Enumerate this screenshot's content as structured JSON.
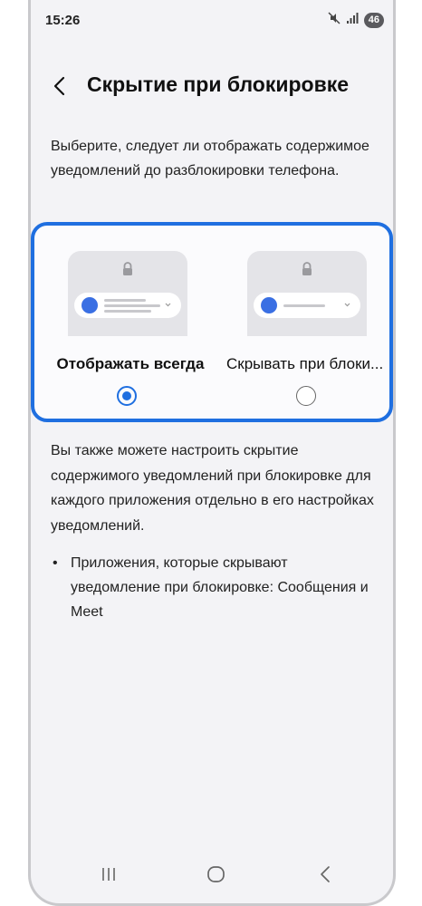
{
  "status": {
    "time": "15:26",
    "battery": "46",
    "icons": [
      "mute-icon",
      "signal-icon",
      "battery-icon"
    ]
  },
  "header": {
    "back_icon": "chevron-left-icon",
    "title": "Скрытие при блокировке"
  },
  "description": "Выберите, следует ли отображать содержимое уведомлений до разблокировки телефона.",
  "options": [
    {
      "label": "Отображать всегда",
      "selected": true
    },
    {
      "label": "Скрывать при блоки...",
      "selected": false
    }
  ],
  "info": "Вы также можете настроить скрытие содержимого уведомлений при блокировке для каждого приложения отдельно в его настройках уведомлений.",
  "bullets": [
    "Приложения, которые скрывают уведомление при блокировке: Сообщения и Meet"
  ],
  "bullet_char": "•",
  "navigation": [
    "recents-icon",
    "home-icon",
    "back-icon"
  ],
  "colors": {
    "accent": "#1f6fe0",
    "background": "#f3f3f6",
    "notification_dot": "#3a6fe3"
  }
}
